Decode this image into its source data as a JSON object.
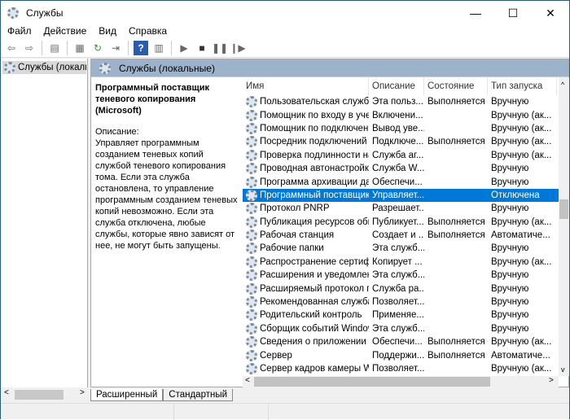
{
  "window": {
    "title": "Службы",
    "minimize": "—",
    "maximize": "☐",
    "close": "✕"
  },
  "menu": [
    "Файл",
    "Действие",
    "Вид",
    "Справка"
  ],
  "toolbar": [
    {
      "icon": "back-icon",
      "g": "⇦"
    },
    {
      "icon": "forward-icon",
      "g": "⇨"
    },
    {
      "icon": "show-console-tree-icon",
      "g": "▤"
    },
    {
      "icon": "properties-icon",
      "g": "▦"
    },
    {
      "icon": "refresh-icon",
      "g": "↻"
    },
    {
      "icon": "export-list-icon",
      "g": "⇥"
    },
    {
      "icon": "help-icon",
      "g": "?"
    },
    {
      "icon": "action-pane-icon",
      "g": "▥"
    },
    {
      "icon": "start-icon",
      "g": "▶"
    },
    {
      "icon": "stop-icon",
      "g": "■"
    },
    {
      "icon": "pause-icon",
      "g": "❚❚"
    },
    {
      "icon": "resume-icon",
      "g": "❙▶"
    }
  ],
  "tree": {
    "item": "Службы (локальные)"
  },
  "panel": {
    "title": "Службы (локальные)"
  },
  "details": {
    "title": "Программный поставщик теневого копирования (Microsoft)",
    "desc_label": "Описание:",
    "desc": "Управляет программным созданием теневых копий службой теневого копирования тома. Если эта служба остановлена, то управление программным созданием теневых копий невозможно. Если эта служба отключена, любые службы, которые явно зависят от нее, не могут быть запущены."
  },
  "columns": [
    "Имя",
    "Описание",
    "Состояние",
    "Тип запуска"
  ],
  "rows": [
    [
      "Пользовательская служба...",
      "Эта польз...",
      "Выполняется",
      "Вручную"
    ],
    [
      "Помощник по входу в уче...",
      "Включени...",
      "",
      "Вручную (ак..."
    ],
    [
      "Помощник по подключен...",
      "Вывод уве...",
      "",
      "Вручную (ак..."
    ],
    [
      "Посредник подключений ...",
      "Подключе...",
      "Выполняется",
      "Вручную (ак..."
    ],
    [
      "Проверка подлинности на...",
      "Служба аг...",
      "",
      "Вручную (ак..."
    ],
    [
      "Проводная автонастройка",
      "Служба W...",
      "",
      "Вручную"
    ],
    [
      "Программа архивации да...",
      "Обеспечи...",
      "",
      "Вручную"
    ],
    [
      "Программный поставщик...",
      "Управляет...",
      "",
      "Отключена"
    ],
    [
      "Протокол PNRP",
      "Разрешает...",
      "",
      "Вручную"
    ],
    [
      "Публикация ресурсов обн...",
      "Публикует...",
      "Выполняется",
      "Вручную (ак..."
    ],
    [
      "Рабочая станция",
      "Создает и ...",
      "Выполняется",
      "Автоматиче..."
    ],
    [
      "Рабочие папки",
      "Эта служб...",
      "",
      "Вручную"
    ],
    [
      "Распространение сертифи...",
      "Копирует ...",
      "",
      "Вручную (ак..."
    ],
    [
      "Расширения и уведомлен...",
      "Эта служб...",
      "",
      "Вручную"
    ],
    [
      "Расширяемый протокол п...",
      "Служба ра...",
      "",
      "Вручную"
    ],
    [
      "Рекомендованная служба ...",
      "Позволяет...",
      "",
      "Вручную"
    ],
    [
      "Родительский контроль",
      "Применяе...",
      "",
      "Вручную"
    ],
    [
      "Сборщик событий Windows",
      "Эта служб...",
      "",
      "Вручную"
    ],
    [
      "Сведения о приложении",
      "Обеспечи...",
      "Выполняется",
      "Вручную (ак..."
    ],
    [
      "Сервер",
      "Поддержи...",
      "Выполняется",
      "Автоматиче..."
    ],
    [
      "Сервер кадров камеры Wi...",
      "Позволяет...",
      "",
      "Вручную (ак..."
    ]
  ],
  "selected_row": 7,
  "tabs": [
    "Расширенный",
    "Стандартный"
  ],
  "active_tab": 0,
  "colors": {
    "selection": "#0078d7",
    "panel_header": "#9db3cb"
  }
}
